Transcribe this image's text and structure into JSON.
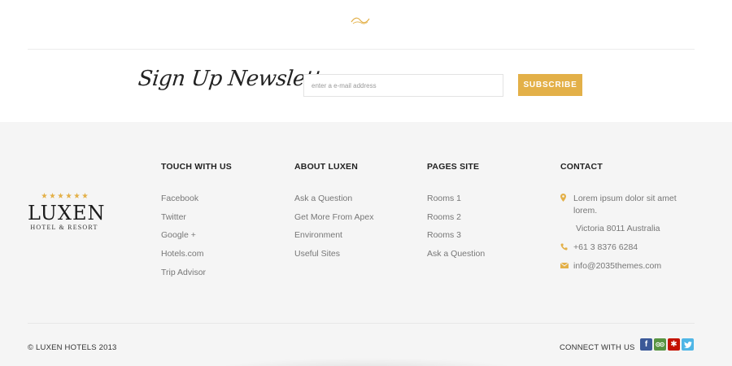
{
  "newsletter": {
    "title": "Sign Up Newsletter",
    "email_placeholder": "enter a e-mail address",
    "subscribe_label": "SUBSCRIBE"
  },
  "logo": {
    "stars": 6,
    "name": "LUXEN",
    "tagline": "HOTEL & RESORT"
  },
  "columns": [
    {
      "heading": "TOUCH WITH US",
      "links": [
        "Facebook",
        "Twitter",
        "Google +",
        "Hotels.com",
        "Trip Advisor"
      ]
    },
    {
      "heading": "ABOUT LUXEN",
      "links": [
        "Ask a Question",
        "Get More From Apex",
        "Environment",
        "Useful Sites"
      ]
    },
    {
      "heading": "PAGES SITE",
      "links": [
        "Rooms 1",
        "Rooms 2",
        "Rooms 3",
        "Ask a Question"
      ]
    }
  ],
  "contact": {
    "heading": "CONTACT",
    "address_line1": "Lorem ipsum dolor sit amet",
    "address_line2": "lorem.",
    "address_line3": "Victoria 8011 Australia",
    "phone": "+61 3 8376 6284",
    "email": "info@2035themes.com"
  },
  "footer": {
    "copyright": "© LUXEN HOTELS 2013",
    "connect_label": "CONNECT WITH US",
    "social": [
      {
        "icon": "facebook-icon",
        "glyph": "f",
        "color": "#3b5998"
      },
      {
        "icon": "tripadvisor-icon",
        "glyph": "",
        "color": "#589442"
      },
      {
        "icon": "yelp-icon",
        "glyph": "y",
        "color": "#c41200"
      },
      {
        "icon": "twitter-icon",
        "glyph": "t",
        "color": "#4fb6e6"
      }
    ]
  },
  "colors": {
    "accent": "#e3b048",
    "footer_bg": "#f5f5f5",
    "heading": "#222222",
    "link": "#777777"
  }
}
